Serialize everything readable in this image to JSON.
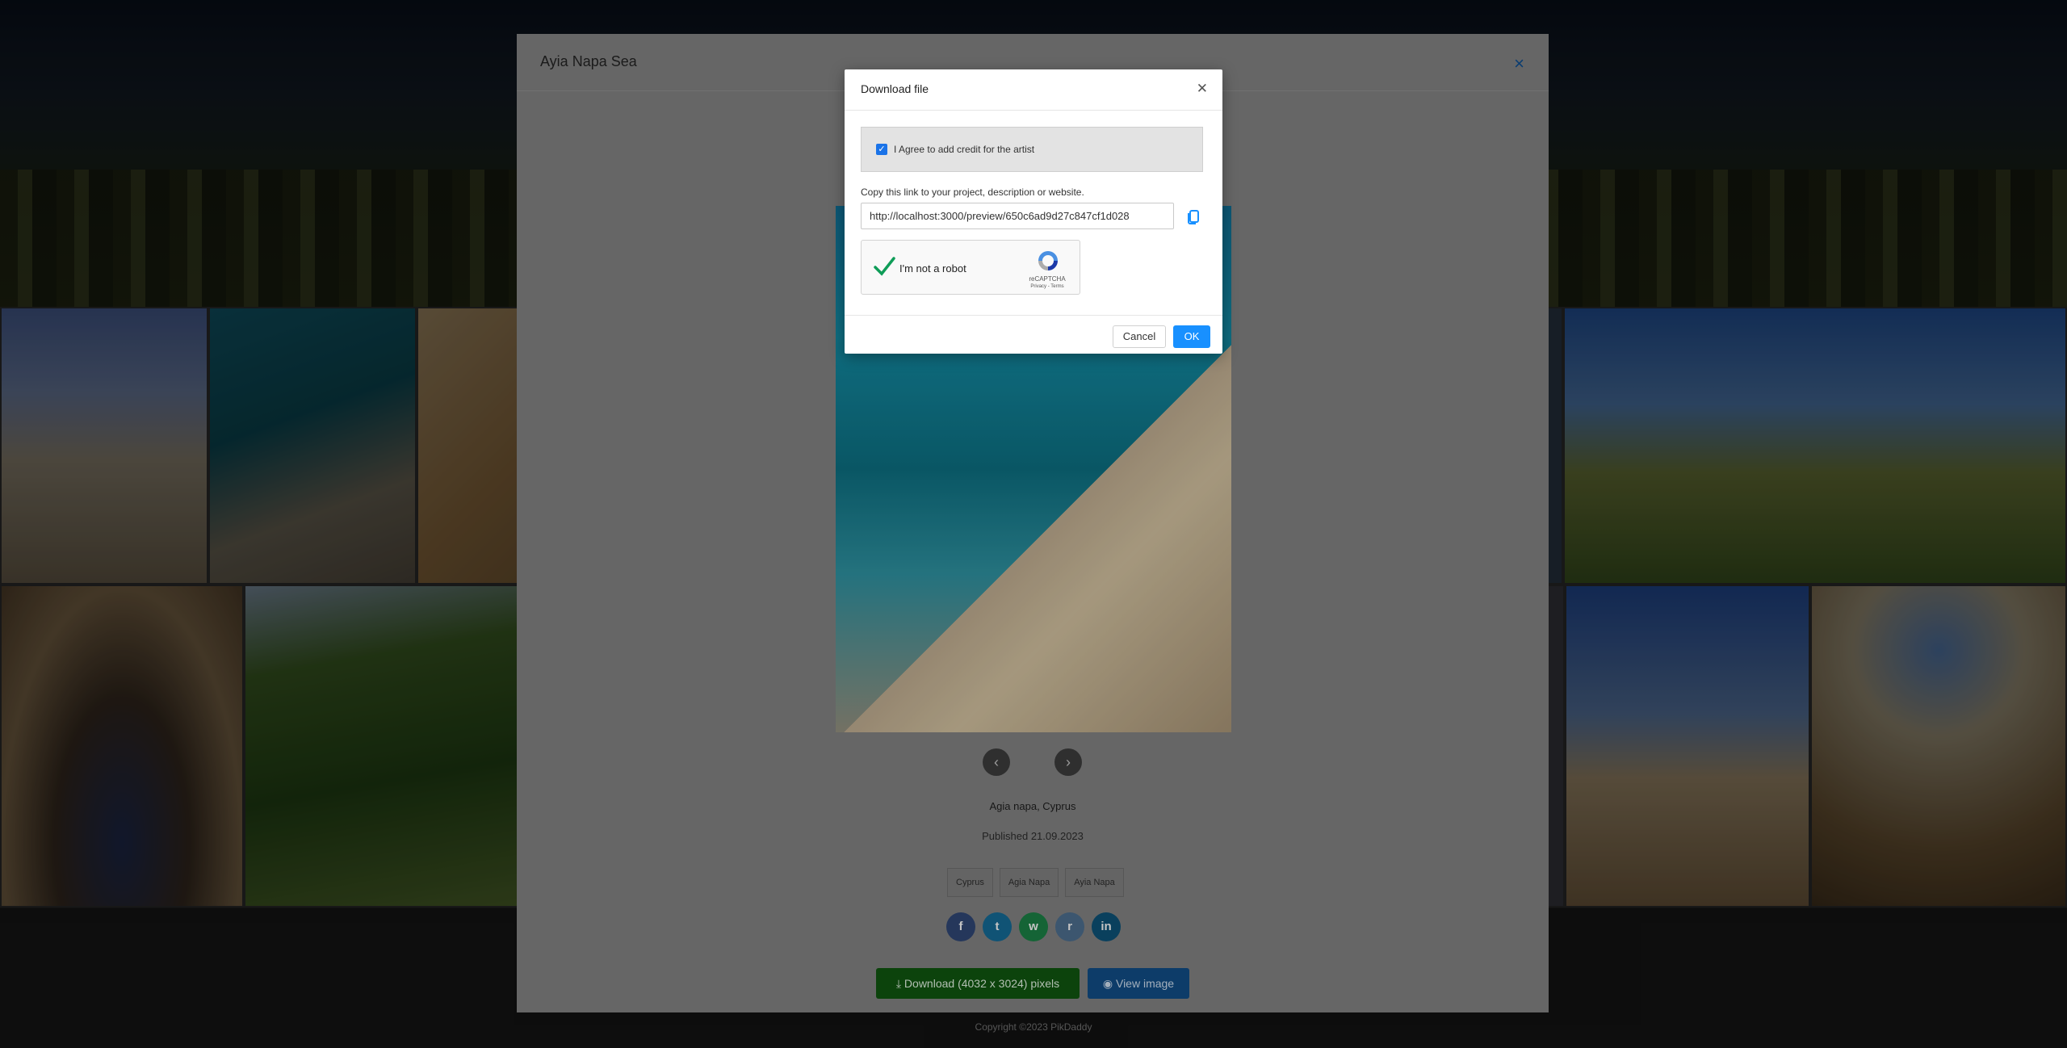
{
  "modal": {
    "title": "Ayia Napa Sea",
    "close_icon": "×",
    "location": "Agia napa, Cyprus",
    "published": "Published 21.09.2023",
    "tags": [
      "Cyprus",
      "Agia Napa",
      "Ayia Napa"
    ],
    "share": [
      {
        "icon": "facebook-icon",
        "glyph": "f",
        "color": "#3b5998"
      },
      {
        "icon": "twitter-icon",
        "glyph": "t",
        "color": "#1da1f2"
      },
      {
        "icon": "whatsapp-icon",
        "glyph": "w",
        "color": "#25d366"
      },
      {
        "icon": "reddit-icon",
        "glyph": "r",
        "color": "#5f99cf"
      },
      {
        "icon": "linkedin-icon",
        "glyph": "in",
        "color": "#0e76a8"
      }
    ],
    "download_label": "Download (4032 x 3024) pixels",
    "view_label": "View image"
  },
  "dialog": {
    "title": "Download file",
    "agree_label": "I Agree to add credit for the artist",
    "agree_checked": true,
    "copy_label": "Copy this link to your project, description or website.",
    "link_value": "http://localhost:3000/preview/650c6ad9d27c847cf1d028",
    "recaptcha": {
      "label": "I'm not a robot",
      "brand": "reCAPTCHA",
      "links": "Privacy - Terms"
    },
    "cancel_label": "Cancel",
    "ok_label": "OK"
  },
  "footer": {
    "copyright": "Copyright ©2023 PikDaddy"
  }
}
